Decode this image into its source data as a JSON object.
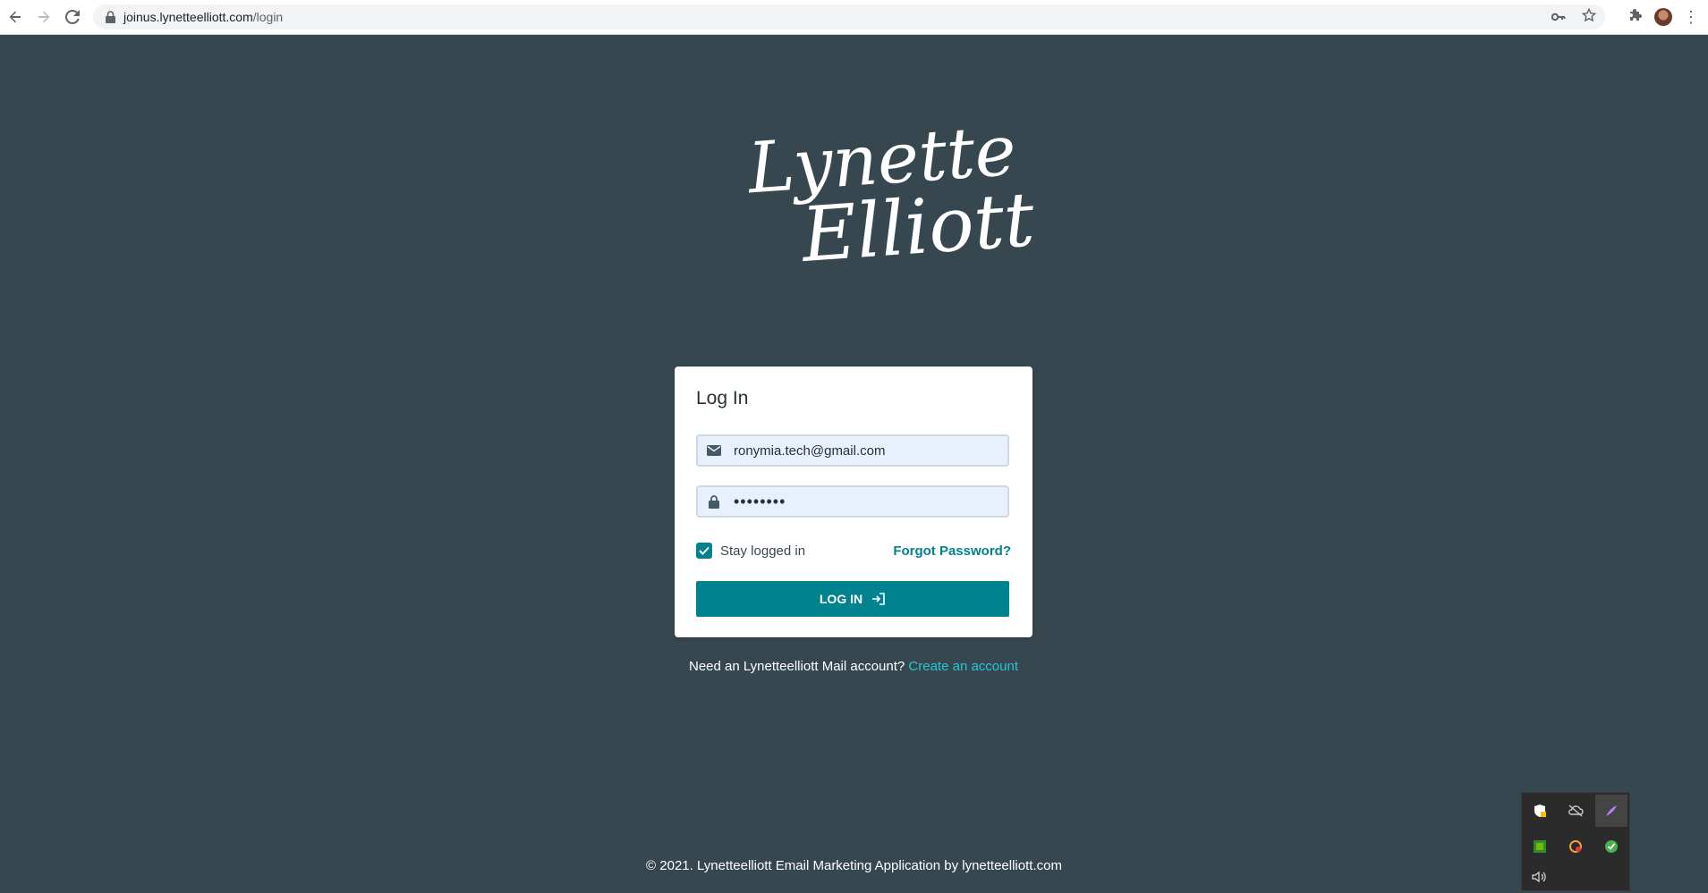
{
  "browser": {
    "url_domain": "joinus.lynetteelliott.com",
    "url_path": "/login"
  },
  "logo": {
    "line1": "Lynette",
    "line2": "Elliott"
  },
  "login": {
    "title": "Log In",
    "email_value": "ronymia.tech@gmail.com",
    "password_value": "••••••••",
    "remember_label": "Stay logged in",
    "remember_checked": true,
    "forgot_label": "Forgot Password?",
    "button_label": "LOG IN"
  },
  "signup": {
    "prompt": "Need an Lynetteelliott Mail account?",
    "link": "Create an account"
  },
  "footer": {
    "text": "© 2021. Lynetteelliott Email Marketing Application by lynetteelliott.com"
  },
  "colors": {
    "background": "#37474f",
    "accent": "#00838f",
    "link": "#26c6da"
  },
  "tray_icons": [
    "security-shield-icon",
    "cloud-offline-icon",
    "pen-icon",
    "nvidia-icon",
    "disk-icon",
    "check-badge-icon",
    "volume-icon"
  ]
}
